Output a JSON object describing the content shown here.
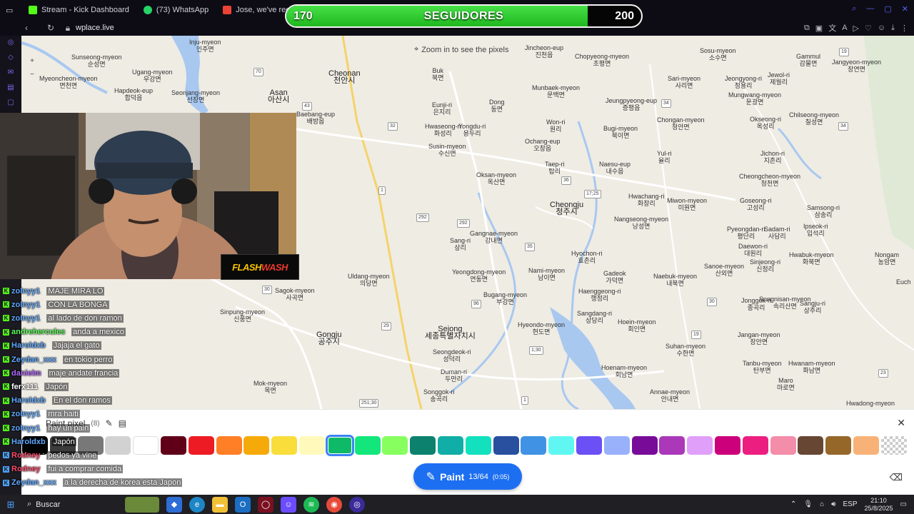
{
  "browser": {
    "tabs": [
      {
        "label": "Stream - Kick Dashboard",
        "icon": "kick-icon",
        "color": "#53fc18"
      },
      {
        "label": "(73) WhatsApp",
        "icon": "whatsapp-icon",
        "color": "#25d366"
      },
      {
        "label": "Jose, we've receiv",
        "icon": "gmail-icon",
        "color": "#ea4335"
      }
    ],
    "url": "wplace.live"
  },
  "followers": {
    "current": "170",
    "label": "SEGUIDORES",
    "goal": "200",
    "progress": 0.85
  },
  "map": {
    "zoom_hint": "Zoom in to see the pixels",
    "labels": [
      {
        "t": "Inju-myeon",
        "k": "인주면"
      },
      {
        "t": "Sunseong-myeon",
        "k": "순성면"
      },
      {
        "t": "Myeoncheon-myeon",
        "k": "면천면"
      },
      {
        "t": "Ugang-myeon",
        "k": "우강면"
      },
      {
        "t": "Hapdeok-eup",
        "k": "합덕읍"
      },
      {
        "t": "Seonjang-myeon",
        "k": "선장면"
      },
      {
        "t": "Asan",
        "k": "아산시"
      },
      {
        "t": "Cheonan",
        "k": "천안시"
      },
      {
        "t": "Baebang-eup",
        "k": "배방읍"
      },
      {
        "t": "Buk",
        "k": "북면"
      },
      {
        "t": "Eunji-ri",
        "k": "은지리"
      },
      {
        "t": "Dong",
        "k": "동면"
      },
      {
        "t": "Hwaseong-ri",
        "k": "화성리"
      },
      {
        "t": "Yongdu-ri",
        "k": "용두리"
      },
      {
        "t": "Susin-myeon",
        "k": "수신면"
      },
      {
        "t": "Jincheon-eup",
        "k": "진천읍"
      },
      {
        "t": "Munbaek-myeon",
        "k": "문백면"
      },
      {
        "t": "Chopyeong-myeon",
        "k": "초평면"
      },
      {
        "t": "Sosu-myeon",
        "k": "소수면"
      },
      {
        "t": "Gammul",
        "k": "감물면"
      },
      {
        "t": "Jangyeon-myeon",
        "k": "장연면"
      },
      {
        "t": "Sari-myeon",
        "k": "사리면"
      },
      {
        "t": "Jeongyong-ri",
        "k": "정용리"
      },
      {
        "t": "Jewol-ri",
        "k": "제월리"
      },
      {
        "t": "Mungwang-myeon",
        "k": "문광면"
      },
      {
        "t": "Jeungpyeong-eup",
        "k": "증평읍"
      },
      {
        "t": "Won-ri",
        "k": "원리"
      },
      {
        "t": "Ochang-eup",
        "k": "오창읍"
      },
      {
        "t": "Bugi-myeon",
        "k": "북이면"
      },
      {
        "t": "Chongan-myeon",
        "k": "청안면"
      },
      {
        "t": "Okseong-ri",
        "k": "옥성리"
      },
      {
        "t": "Chilseong-myeon",
        "k": "칠성면"
      },
      {
        "t": "Taep-ri",
        "k": "탑리"
      },
      {
        "t": "Oksan-myeon",
        "k": "옥산면"
      },
      {
        "t": "Naesu-eup",
        "k": "내수읍"
      },
      {
        "t": "Yul-ri",
        "k": "율리"
      },
      {
        "t": "Jichon-ri",
        "k": "지촌리"
      },
      {
        "t": "Cheongcheon-myeon",
        "k": "청천면"
      },
      {
        "t": "Cheongju",
        "k": "청주시"
      },
      {
        "t": "Hwachang-ri",
        "k": "화창리"
      },
      {
        "t": "Miwon-myeon",
        "k": "미원면"
      },
      {
        "t": "Goseong-ri",
        "k": "고성리"
      },
      {
        "t": "Samsong-ri",
        "k": "삼송리"
      },
      {
        "t": "Nangseong-myeon",
        "k": "낭성면"
      },
      {
        "t": "Sadam-ri",
        "k": "사담리"
      },
      {
        "t": "Ipseok-ri",
        "k": "입석리"
      },
      {
        "t": "Pyeongdan-ri",
        "k": "평단리"
      },
      {
        "t": "Daewon-ri",
        "k": "대원리"
      },
      {
        "t": "Gangnae-myeon",
        "k": "강내면"
      },
      {
        "t": "Sang-ri",
        "k": "상리"
      },
      {
        "t": "Hwabuk-myeon",
        "k": "화북면"
      },
      {
        "t": "Nongam",
        "k": "농암면"
      },
      {
        "t": "Yeongdong-myeon",
        "k": "연동면"
      },
      {
        "t": "Nami-myeon",
        "k": "남이면"
      },
      {
        "t": "Hyochon-ri",
        "k": "효촌리"
      },
      {
        "t": "Gadeok",
        "k": "가덕면"
      },
      {
        "t": "Naebuk-myeon",
        "k": "내북면"
      },
      {
        "t": "Sanoe-myeon",
        "k": "산외면"
      },
      {
        "t": "Sinjeong-ri",
        "k": "신정리"
      },
      {
        "t": "Uldang-myeon",
        "k": "의당면"
      },
      {
        "t": "Sagok-myeon",
        "k": "사곡면"
      },
      {
        "t": "Bugang-myeon",
        "k": "부강면"
      },
      {
        "t": "Haenggeong-ri",
        "k": "행정리"
      },
      {
        "t": "Jonggok-ri",
        "k": "종곡리"
      },
      {
        "t": "Songnisan-myeon",
        "k": "속리산면"
      },
      {
        "t": "Sangju-ri",
        "k": "상주리"
      },
      {
        "t": "Sinpung-myeon",
        "k": "신풍면"
      },
      {
        "t": "Sangdang-ri",
        "k": "상당리"
      },
      {
        "t": "Hoein-myeon",
        "k": "회인면"
      },
      {
        "t": "Sejong",
        "k": "세종특별자치시"
      },
      {
        "t": "Hyeondo-myeon",
        "k": "현도면"
      },
      {
        "t": "Gongju",
        "k": "공주시"
      },
      {
        "t": "Jangan-myeon",
        "k": "장안면"
      },
      {
        "t": "Seongdeok-ri",
        "k": "성덕리"
      },
      {
        "t": "Suhan-myeon",
        "k": "수한면"
      },
      {
        "t": "Tanbu-myeon",
        "k": "탄부면"
      },
      {
        "t": "Hwanam-myeon",
        "k": "화남면"
      },
      {
        "t": "Duman-ri",
        "k": "두만리"
      },
      {
        "t": "Hoenam-myeon",
        "k": "회남면"
      },
      {
        "t": "Maro",
        "k": "마로면"
      },
      {
        "t": "Mok-myeon",
        "k": "목면"
      },
      {
        "t": "Songgok-ri",
        "k": "송곡리"
      },
      {
        "t": "Annae-myeon",
        "k": "안내면"
      },
      {
        "t": "Hwadong-myeon",
        "k": ""
      },
      {
        "t": "Euch",
        "k": ""
      }
    ],
    "roads": [
      "43",
      "70",
      "32",
      "34",
      "34",
      "1",
      "36",
      "17;25",
      "292",
      "292",
      "35",
      "96",
      "29",
      "1;30",
      "30",
      "19",
      "30",
      "23",
      "251;30",
      "1",
      "19"
    ]
  },
  "chat": [
    {
      "user": "zolnyy1",
      "text": "MAJE MIRA LO",
      "color": "#5fa8ff"
    },
    {
      "user": "zolnyy1",
      "text": "CON LA BONGA",
      "color": "#5fa8ff"
    },
    {
      "user": "zolnyy1",
      "text": "al lado de don ramon",
      "color": "#5fa8ff"
    },
    {
      "user": "andrehercules",
      "text": "anda a mexico",
      "color": "#5dff5d"
    },
    {
      "user": "Haroldxb",
      "text": "Jajaja el gato",
      "color": "#5fa8ff"
    },
    {
      "user": "Zeydan_xxx",
      "text": "en tokio perro",
      "color": "#5fa8ff"
    },
    {
      "user": "danielm",
      "text": "maje andate francia",
      "color": "#b46bff"
    },
    {
      "user": "ferx111",
      "text": "Japón",
      "color": "#ffffff"
    },
    {
      "user": "Haroldxb",
      "text": "En el don ramos",
      "color": "#5fa8ff"
    },
    {
      "user": "zolnyy1",
      "text": "mra haiti",
      "color": "#5fa8ff"
    },
    {
      "user": "zolnyy1",
      "text": "hay un pain",
      "color": "#5fa8ff"
    },
    {
      "user": "Haroldxb",
      "text": "Japón",
      "color": "#5fa8ff"
    },
    {
      "user": "Rodney",
      "text": "pedos ya vine",
      "color": "#ff4d6d"
    },
    {
      "user": "Rodney",
      "text": "fui a comprar comida",
      "color": "#ff4d6d"
    },
    {
      "user": "Zeydan_xxx",
      "text": "a la derecha de korea esta Japon",
      "color": "#5fa8ff"
    }
  ],
  "paint": {
    "title": "Paint pixel",
    "count": "(8)",
    "button_label": "Paint",
    "charges": "13/64",
    "timer": "(0:05)",
    "colors": [
      "#000000",
      "#3c3c3c",
      "#787878",
      "#d2d2d2",
      "#ffffff",
      "#600018",
      "#ed1c24",
      "#ff7f27",
      "#f6aa09",
      "#f9dd3b",
      "#fffabc",
      "#0eb968",
      "#13e67b",
      "#87ff5e",
      "#0c816e",
      "#10aea6",
      "#13e1be",
      "#28509e",
      "#4093e4",
      "#60f7f2",
      "#6b50f6",
      "#99b1fb",
      "#780c99",
      "#aa38b9",
      "#e09ff9",
      "#cb007a",
      "#ec1f80",
      "#f38da9",
      "#684634",
      "#95682a",
      "#f8b277",
      "transparent"
    ],
    "selected_index": 11
  },
  "overlay": {
    "logo_text_a": "FLASH",
    "logo_text_b": "WASH"
  },
  "taskbar": {
    "search_label": "Buscar",
    "lang": "ESP",
    "time": "21:10",
    "date": "25/8/2025"
  }
}
